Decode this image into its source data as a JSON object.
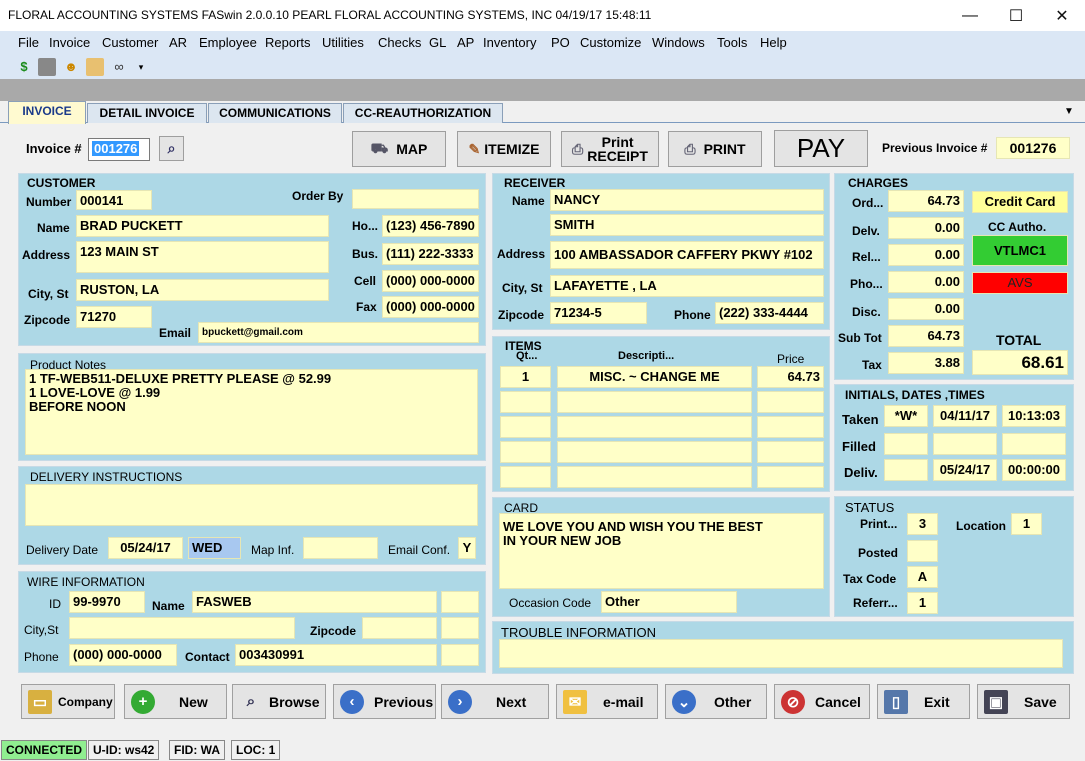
{
  "window": {
    "title": "FLORAL ACCOUNTING SYSTEMS  FASwin 2.0.0.10   PEARL   FLORAL ACCOUNTING SYSTEMS, INC   04/19/17  15:48:11",
    "minimize": "—",
    "maximize": "☐",
    "close": "✕"
  },
  "menu": [
    "File",
    "Invoice",
    "Customer",
    "AR",
    "Employee",
    "Reports",
    "Utilities",
    "Checks",
    "GL",
    "AP",
    "Inventory",
    "PO",
    "Customize",
    "Windows",
    "Tools",
    "Help"
  ],
  "tabs": [
    "INVOICE",
    "DETAIL INVOICE",
    "COMMUNICATIONS",
    "CC-REAUTHORIZATION"
  ],
  "top": {
    "invoice_label": "Invoice #",
    "invoice_value": "001276",
    "map": "MAP",
    "itemize": "ITEMIZE",
    "print_receipt": "Print\nRECEIPT",
    "print": "PRINT",
    "pay": "PAY",
    "prev_label": "Previous Invoice #",
    "prev_value": "001276"
  },
  "customer": {
    "title": "CUSTOMER",
    "number_label": "Number",
    "number": "000141",
    "orderby_label": "Order By",
    "orderby": "",
    "name_label": "Name",
    "name": "BRAD PUCKETT",
    "home_label": "Ho...",
    "home": "(123) 456-7890",
    "address_label": "Address",
    "address": "123 MAIN ST",
    "bus_label": "Bus.",
    "bus": "(111) 222-3333",
    "cell_label": "Cell",
    "cell": "(000) 000-0000",
    "city_label": "City, St",
    "city": "RUSTON, LA",
    "fax_label": "Fax",
    "fax": "(000) 000-0000",
    "zip_label": "Zipcode",
    "zip": "71270",
    "email_label": "Email",
    "email": "bpuckett@gmail.com"
  },
  "receiver": {
    "title": "RECEIVER",
    "name_label": "Name",
    "name1": "NANCY",
    "name2": "SMITH",
    "address_label": "Address",
    "address": "100 AMBASSADOR CAFFERY PKWY #102",
    "city_label": "City, St",
    "city": "LAFAYETTE , LA",
    "zip_label": "Zipcode",
    "zip": "71234-5",
    "phone_label": "Phone",
    "phone": "(222) 333-4444"
  },
  "charges": {
    "title": "CHARGES",
    "ord_label": "Ord...",
    "ord": "64.73",
    "delv_label": "Delv.",
    "delv": "0.00",
    "rel_label": "Rel...",
    "rel": "0.00",
    "pho_label": "Pho...",
    "pho": "0.00",
    "disc_label": "Disc.",
    "disc": "0.00",
    "subtot_label": "Sub Tot",
    "subtot": "64.73",
    "tax_label": "Tax",
    "tax": "3.88",
    "total_label": "TOTAL",
    "total": "68.61",
    "payment": "Credit Card",
    "ccauth_label": "CC Autho.",
    "ccauth": "VTLMC1",
    "avs": "AVS"
  },
  "product_notes": {
    "title": "Product Notes",
    "text": "1 TF-WEB511-DELUXE PRETTY PLEASE @ 52.99\n1 LOVE-LOVE @ 1.99\nBEFORE NOON"
  },
  "items": {
    "title": "ITEMS",
    "qty_header": "Qt...",
    "desc_header": "Descripti...",
    "price_header": "Price",
    "rows": [
      {
        "qty": "1",
        "desc": "MISC. ~ CHANGE ME",
        "price": "64.73"
      },
      {
        "qty": "",
        "desc": "",
        "price": ""
      },
      {
        "qty": "",
        "desc": "",
        "price": ""
      },
      {
        "qty": "",
        "desc": "",
        "price": ""
      },
      {
        "qty": "",
        "desc": "",
        "price": ""
      }
    ]
  },
  "initials": {
    "title": "INITIALS, DATES ,TIMES",
    "taken_label": "Taken",
    "taken_init": "*W*",
    "taken_date": "04/11/17",
    "taken_time": "10:13:03",
    "filled_label": "Filled",
    "deliv_label": "Deliv.",
    "deliv_date": "05/24/17",
    "deliv_time": "00:00:00"
  },
  "delivery": {
    "title": "DELIVERY INSTRUCTIONS",
    "text": "",
    "date_label": "Delivery Date",
    "date": "05/24/17",
    "day": "WED",
    "mapinf_label": "Map Inf.",
    "mapinf": "",
    "emailconf_label": "Email Conf.",
    "emailconf": "Y"
  },
  "card": {
    "title": "CARD",
    "text": "WE LOVE YOU AND WISH YOU THE BEST\nIN YOUR NEW JOB",
    "occasion_label": "Occasion Code",
    "occasion": "Other"
  },
  "status": {
    "title": "STATUS",
    "print_label": "Print...",
    "print": "3",
    "location_label": "Location",
    "location": "1",
    "posted_label": "Posted",
    "posted": "",
    "taxcode_label": "Tax Code",
    "taxcode": "A",
    "referr_label": "Referr...",
    "referr": "1"
  },
  "wire": {
    "title": "WIRE INFORMATION",
    "id_label": "ID",
    "id": "99-9970",
    "name_label": "Name",
    "name": "FASWEB",
    "city_label": "City,St",
    "zip_label": "Zipcode",
    "phone_label": "Phone",
    "phone": "(000) 000-0000",
    "contact_label": "Contact",
    "contact": "003430991"
  },
  "trouble": {
    "title": "TROUBLE INFORMATION",
    "text": ""
  },
  "bottom": [
    "Company",
    "New",
    "Browse",
    "Previous",
    "Next",
    "e-mail",
    "Other",
    "Cancel",
    "Exit",
    "Save"
  ],
  "statusbar": {
    "connected": "CONNECTED",
    "uid": "U-ID: ws42",
    "fid": "FID: WA",
    "loc": "LOC: 1"
  },
  "colors": {
    "panel": "#add8e6",
    "field": "#ffffc8",
    "credit": "#ffff99",
    "ccauth": "#33cc33",
    "avs": "#ff0000",
    "connected": "#90ee90"
  }
}
